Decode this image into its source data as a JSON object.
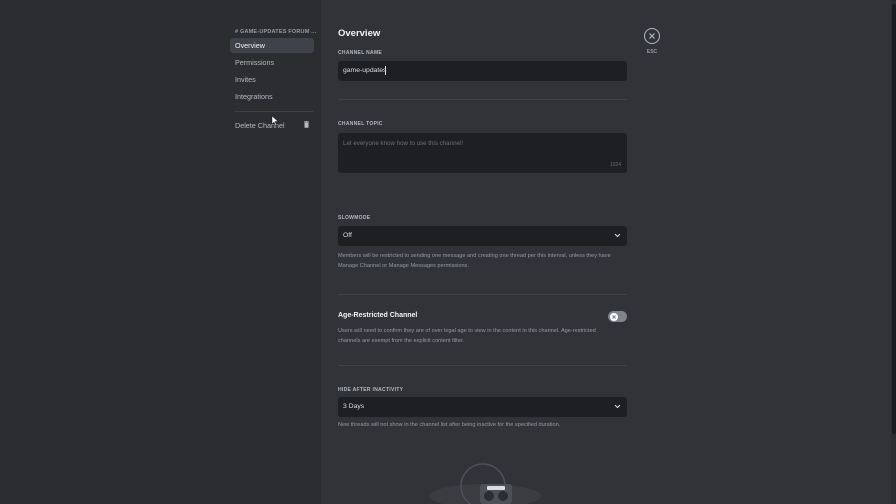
{
  "sidebar": {
    "header": "# GAME-UPDATES FORUM ...",
    "items": [
      {
        "label": "Overview"
      },
      {
        "label": "Permissions"
      },
      {
        "label": "Invites"
      },
      {
        "label": "Integrations"
      }
    ],
    "delete_label": "Delete Channel"
  },
  "main": {
    "title": "Overview",
    "channel_name": {
      "label": "CHANNEL NAME",
      "value": "game-updates"
    },
    "channel_topic": {
      "label": "CHANNEL TOPIC",
      "placeholder": "Let everyone know how to use this channel!",
      "counter": "1024"
    },
    "slowmode": {
      "label": "SLOWMODE",
      "value": "Off",
      "desc_line1": "Members will be restricted to sending one message and creating one thread per this interval, unless they have",
      "desc_line2": "Manage Channel or Manage Messages permissions."
    },
    "age_restricted": {
      "title": "Age-Restricted Channel",
      "desc_line1": "Users will need to confirm they are of over legal age to view in the content in this channel. Age-restricted",
      "desc_line2": "channels are exempt from the explicit content filter.",
      "enabled": false
    },
    "hide_after_inactivity": {
      "label": "HIDE AFTER INACTIVITY",
      "value": "3 Days",
      "desc": "New threads will not show in the channel list after being inactive for the specified duration."
    }
  },
  "close": {
    "label": "ESC"
  },
  "colors": {
    "background": "#313338",
    "sidebar": "#2b2d31",
    "input": "#1e1f22",
    "toggle_off": "#80848e"
  }
}
